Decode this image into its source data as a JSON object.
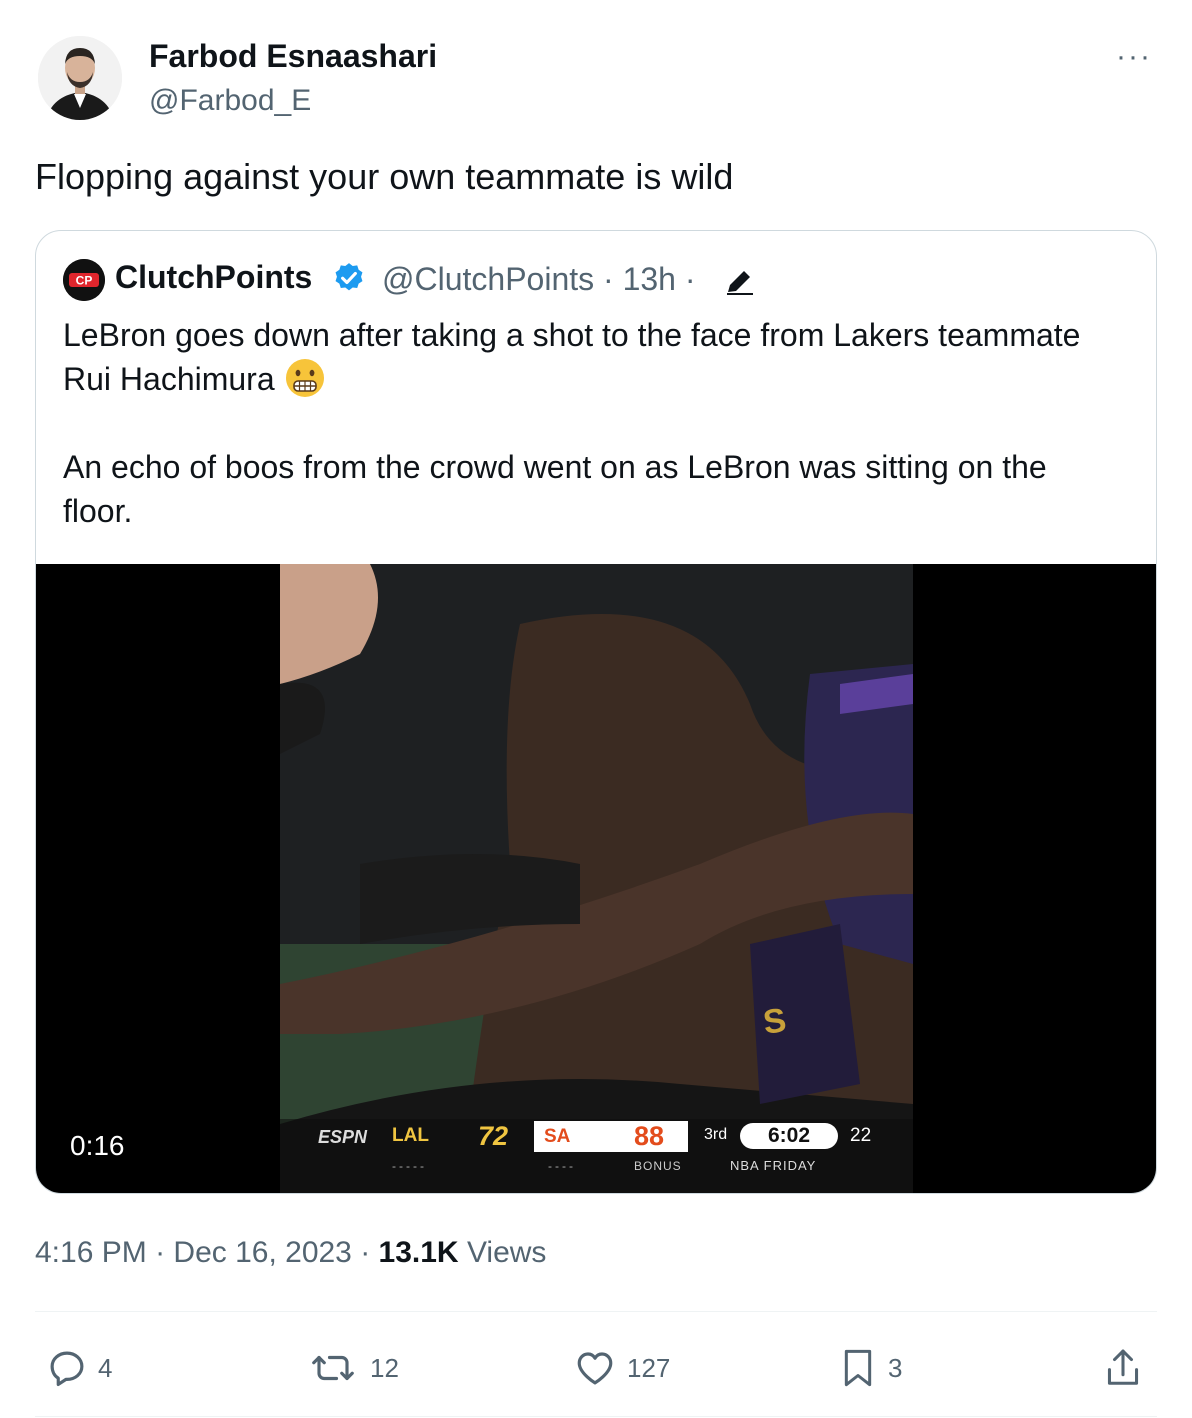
{
  "tweet": {
    "author_name": "Farbod Esnaashari",
    "author_handle": "@Farbod_E",
    "more_label": "···",
    "text": "Flopping against your own teammate is wild"
  },
  "quote": {
    "author_name": "ClutchPoints",
    "author_handle": "@ClutchPoints · 13h ·",
    "text_p1": "LeBron goes down after taking a shot to the face from Lakers teammate Rui Hachimura",
    "text_p2": "An echo of boos from the crowd went on as LeBron was sitting on the floor.",
    "video": {
      "duration": "0:16",
      "scorebug": {
        "network": "ESPN",
        "home_abbr": "LAL",
        "home_score": "72",
        "away_abbr": "SA",
        "away_score": "88",
        "period": "3rd",
        "clock": "6:02",
        "shot_clock": "22",
        "bonus": "BONUS",
        "footer": "NBA FRIDAY",
        "dashes_home": "-----",
        "dashes_away": "----"
      }
    }
  },
  "meta": {
    "time": "4:16 PM",
    "sep1": " · ",
    "date": "Dec 16, 2023",
    "sep2": " · ",
    "views_count": "13.1K",
    "views_label": " Views"
  },
  "actions": {
    "replies": "4",
    "reposts": "12",
    "likes": "127",
    "bookmarks": "3"
  },
  "colors": {
    "text_primary": "#0f1419",
    "text_secondary": "#536471",
    "verified": "#1d9bf0",
    "border": "#cfd9de"
  }
}
